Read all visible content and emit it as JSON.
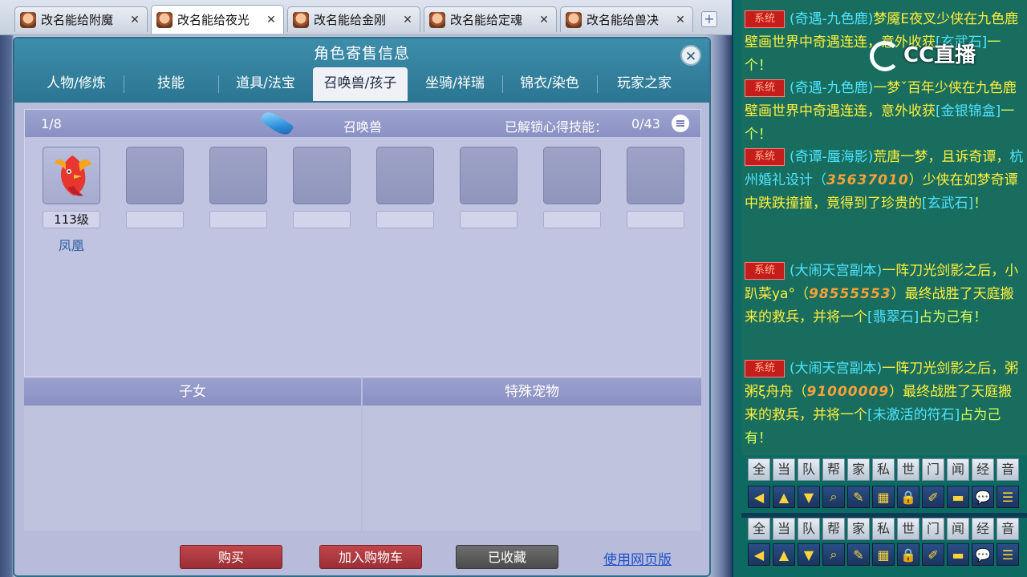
{
  "browser": {
    "tabs": [
      {
        "label": "改名能给附魔",
        "close": "✕"
      },
      {
        "label": "改名能给夜光",
        "close": "✕",
        "active": true
      },
      {
        "label": "改名能给金刚",
        "close": "✕"
      },
      {
        "label": "改名能给定魂",
        "close": "✕"
      },
      {
        "label": "改名能给兽决",
        "close": "✕"
      }
    ],
    "add_tab": "+"
  },
  "panel": {
    "title": "角色寄售信息",
    "close": "✕",
    "tabs": [
      "人物/修炼",
      "技能",
      "道具/法宝",
      "召唤兽/孩子",
      "坐骑/祥瑞",
      "锦衣/染色",
      "玩家之家"
    ],
    "active_tab": "召唤兽/孩子"
  },
  "summon": {
    "count": "1/8",
    "title": "召唤兽",
    "skill_label": "已解锁心得技能：",
    "skill_value": "0/43",
    "pets": [
      {
        "level": "113级",
        "name": "凤凰"
      }
    ]
  },
  "children": {
    "title": "子女"
  },
  "special_pets": {
    "title": "特殊宠物"
  },
  "buttons": {
    "buy": "购买",
    "add_cart": "加入购物车",
    "favorited": "已收藏",
    "web_version": "使用网页版"
  },
  "chat": {
    "logo": "CC直播",
    "sys_label": "系统",
    "messages": [
      {
        "a": "(奇遇-九色鹿)",
        "b": "梦魇E夜叉少侠在九色鹿壁画世界中奇遇连连，意外收获",
        "c": "[玄武石]",
        "d": "一个！"
      },
      {
        "a": "(奇遇-九色鹿)",
        "b": "一梦ˇ百年少侠在九色鹿壁画世界中奇遇连连，意外收获",
        "c": "[金银锦盒]",
        "d": "一个！"
      },
      {
        "a": "(奇谭-蜃海影)",
        "b": "荒唐一梦，且诉奇谭，",
        "e": "杭州婚礼设计（",
        "num": "3563701",
        "f": "0",
        "g": "）少侠在如梦奇谭中跌跌撞撞，竟得到了珍贵的",
        "c": "[玄武石]",
        "d": "！"
      },
      {
        "a": "(大闹天宫副本)",
        "b": "一阵刀光剑影之后，",
        "e": "小趴菜ya°（",
        "num": "98555553",
        "g": "）最终战胜了天庭搬来的救兵，并将一个",
        "c": "[翡翠石]",
        "d": "占为己有！"
      },
      {
        "a": "(大闹天宫副本)",
        "b": "一阵刀光剑影之后，",
        "e": "粥粥ξ舟舟（",
        "num": "91000009",
        "g": "）最终战胜了天庭搬来的救兵，并将一个",
        "c": "[未激活的符石]",
        "d": "占为己有！"
      }
    ],
    "channels": [
      "全",
      "当",
      "队",
      "帮",
      "家",
      "私",
      "世",
      "门",
      "闻",
      "经",
      "音"
    ],
    "icons": [
      {
        "name": "left-arrow-icon",
        "glyph": "◀"
      },
      {
        "name": "up-arrow-icon",
        "glyph": "▲"
      },
      {
        "name": "down-arrow-icon",
        "glyph": "▼"
      },
      {
        "name": "search-icon",
        "glyph": "⌕"
      },
      {
        "name": "note-icon",
        "glyph": "✎"
      },
      {
        "name": "grid-icon",
        "glyph": "▦"
      },
      {
        "name": "lock-icon",
        "glyph": "🔒"
      },
      {
        "name": "brush-icon",
        "glyph": "✐"
      },
      {
        "name": "folder-icon",
        "glyph": "▬"
      },
      {
        "name": "chat-bubble-icon",
        "glyph": "💬"
      },
      {
        "name": "list-icon",
        "glyph": "☰"
      }
    ]
  }
}
